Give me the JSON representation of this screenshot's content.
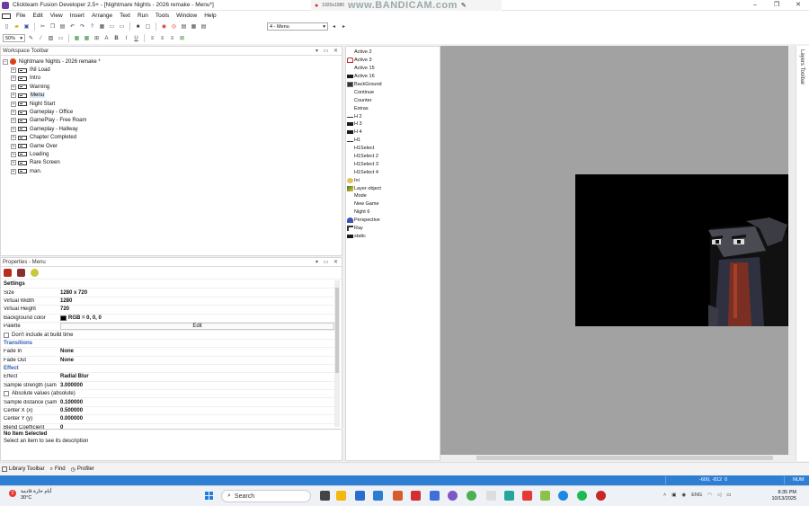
{
  "window": {
    "title": "Clickteam Fusion Developer 2.5+ - [Nightmare Nights - 2026 remake - Menu*]",
    "controls": [
      "–",
      "❐",
      "✕"
    ]
  },
  "overlay": {
    "resolution": "1920x1080",
    "watermark": "www.BANDICAM.com"
  },
  "menubar": [
    "File",
    "Edit",
    "View",
    "Insert",
    "Arrange",
    "Text",
    "Run",
    "Tools",
    "Window",
    "Help"
  ],
  "toolbar": {
    "zoom": "50%",
    "frame_select": "4 - Menu"
  },
  "workspace": {
    "title": "Workspace Toolbar",
    "root": "Nightmare Nights - 2026 remake *",
    "frames": [
      "INI Load",
      "Intro",
      "Warning",
      "Menu",
      "Night Start",
      "Gameplay - Office",
      "GamePlay - Free Roam",
      "Gameplay - Hallway",
      "Chapter Completed",
      "Game Over",
      "Loading",
      "Rare Screen",
      "man."
    ],
    "selected": "Menu"
  },
  "properties": {
    "title": "Properties - Menu",
    "sections": {
      "settings": "Settings",
      "transitions": "Transitions",
      "effect": "Effect"
    },
    "rows": {
      "size": {
        "k": "Size",
        "v": "1280 x 720"
      },
      "vwidth": {
        "k": "Virtual Width",
        "v": "1280"
      },
      "vheight": {
        "k": "Virtual Height",
        "v": "720"
      },
      "bg": {
        "k": "Background color",
        "v": "RGB = 0, 0, 0"
      },
      "palette": {
        "k": "Palette",
        "v": "Edit"
      },
      "dont_include": "Don't include at build time",
      "fade_in": {
        "k": "Fade In",
        "v": "None"
      },
      "fade_out": {
        "k": "Fade Out",
        "v": "None"
      },
      "effect": {
        "k": "Effect",
        "v": "Radial Blur"
      },
      "sample_strength": {
        "k": "Sample strength (sam",
        "v": "3.000000"
      },
      "absolute": "Absolute values (absolute)",
      "sample_distance": {
        "k": "Sample distance (sam",
        "v": "0.100000"
      },
      "center_x": {
        "k": "Center X (x)",
        "v": "0.500000"
      },
      "center_y": {
        "k": "Center Y (y)",
        "v": "0.000000"
      },
      "blend": {
        "k": "Blend Coefficient",
        "v": "0"
      }
    },
    "desc_title": "No Item Selected",
    "desc_text": "Select an item to see its description"
  },
  "objects": [
    {
      "name": "Active 2",
      "icon": "blank"
    },
    {
      "name": "Active 3",
      "icon": "red-figure"
    },
    {
      "name": "Active 15",
      "icon": "blank"
    },
    {
      "name": "Active 16",
      "icon": "dark-bar"
    },
    {
      "name": "BackGround",
      "icon": "dark-thumb"
    },
    {
      "name": "Continue",
      "icon": "blank"
    },
    {
      "name": "Counter",
      "icon": "blank"
    },
    {
      "name": "Extras",
      "icon": "blank"
    },
    {
      "name": "H 2",
      "icon": "line"
    },
    {
      "name": "H 3",
      "icon": "dark-bar"
    },
    {
      "name": "H 4",
      "icon": "dark-bar"
    },
    {
      "name": "H1",
      "icon": "line"
    },
    {
      "name": "H1Select",
      "icon": "blank"
    },
    {
      "name": "H1Select 2",
      "icon": "blank"
    },
    {
      "name": "H1Select 3",
      "icon": "blank"
    },
    {
      "name": "H1Select 4",
      "icon": "blank"
    },
    {
      "name": "Ini",
      "icon": "ini"
    },
    {
      "name": "Layer object",
      "icon": "layer"
    },
    {
      "name": "Mode",
      "icon": "blank"
    },
    {
      "name": "New Game",
      "icon": "blank"
    },
    {
      "name": "Night 6",
      "icon": "blank"
    },
    {
      "name": "Perspective",
      "icon": "perspective"
    },
    {
      "name": "Ray",
      "icon": "ray"
    },
    {
      "name": "static",
      "icon": "dark-bar"
    }
  ],
  "layers_toolbar": "Layers Toolbar",
  "bottom_tabs": [
    "Library Toolbar",
    "Find",
    "Profiler"
  ],
  "status": {
    "coords": "-600, -812",
    "extra": "0",
    "num": "NUM"
  },
  "taskbar": {
    "weather_line1": "أيام حارة قادمة",
    "weather_line2": "30°C",
    "badge": "2",
    "search": "Search",
    "lang": "ENG",
    "time": "8:35 PM",
    "date": "10/13/2025"
  },
  "colors": {
    "statusbar": "#2e7fd4",
    "editor_bg": "#a2a2a2",
    "frame_bg": "#000000",
    "section_blue": "#2b5fb0"
  }
}
